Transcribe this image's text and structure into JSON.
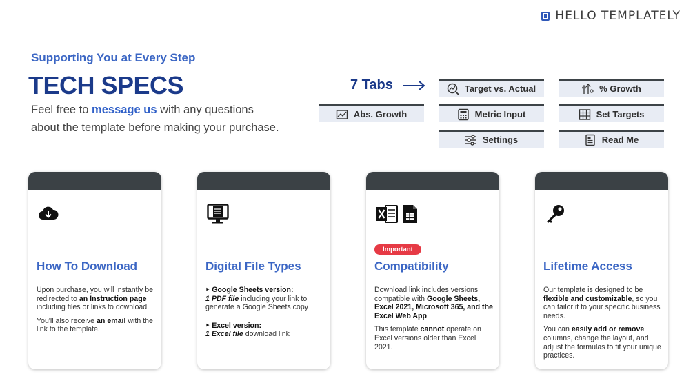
{
  "brand": {
    "name": "HELLO TEMPLATELY"
  },
  "header": {
    "eyebrow": "Supporting You at Every Step",
    "title": "TECH SPECS",
    "intro_prefix": "Feel free to ",
    "intro_link": "message us",
    "intro_suffix": " with any questions about the template before making your purchase."
  },
  "tabs": {
    "label": "7 Tabs",
    "items": [
      {
        "label": "Target vs. Actual",
        "icon": "chart-search-icon"
      },
      {
        "label": "% Growth",
        "icon": "growth-arrows-icon"
      },
      {
        "label": "Abs. Growth",
        "icon": "chart-image-icon"
      },
      {
        "label": "Metric Input",
        "icon": "keypad-icon"
      },
      {
        "label": "Set Targets",
        "icon": "grid-table-icon"
      },
      {
        "label": "Settings",
        "icon": "sliders-icon"
      },
      {
        "label": "Read Me",
        "icon": "document-icon"
      }
    ]
  },
  "cards": [
    {
      "title": "How To Download",
      "icon": "cloud-download-icon",
      "p1_a": "Upon purchase, you will instantly be redirected to ",
      "p1_b": "an Instruction page",
      "p1_c": " including files or links to download.",
      "p2_a": "You'll also receive ",
      "p2_b": "an email",
      "p2_c": " with the link to the template."
    },
    {
      "title": "Digital File Types",
      "icon": "computer-file-icon",
      "b1_head": "‣ Google Sheets version:",
      "b1_em": "1 PDF file",
      "b1_rest": " including your link to generate a Google Sheets copy",
      "b2_head": "‣ Excel version:",
      "b2_em": "1 Excel file",
      "b2_rest": " download link"
    },
    {
      "title": "Compatibility",
      "icon": "excel-sheets-icon",
      "badge": "Important",
      "p1_a": "Download link includes versions compatible with ",
      "p1_b": "Google Sheets, Excel 2021, Microsoft 365, and the Excel Web App",
      "p1_c": ".",
      "p2_a": "This template ",
      "p2_b": "cannot",
      "p2_c": " operate on Excel versions older than Excel 2021."
    },
    {
      "title": "Lifetime Access",
      "icon": "key-icon",
      "p1_a": "Our template is designed to be ",
      "p1_b": "flexible and customizable",
      "p1_c": ", so you can tailor it to your specific business needs.",
      "p2_a": "You can ",
      "p2_b": "easily add or remove",
      "p2_c": " columns, change the layout, and adjust the formulas to fit your unique practices."
    }
  ],
  "colors": {
    "accent": "#3b66c4",
    "title": "#1b3a8a",
    "card_head": "#3b4145",
    "tab_bg": "#e8ecf4",
    "badge": "#e63a45"
  }
}
